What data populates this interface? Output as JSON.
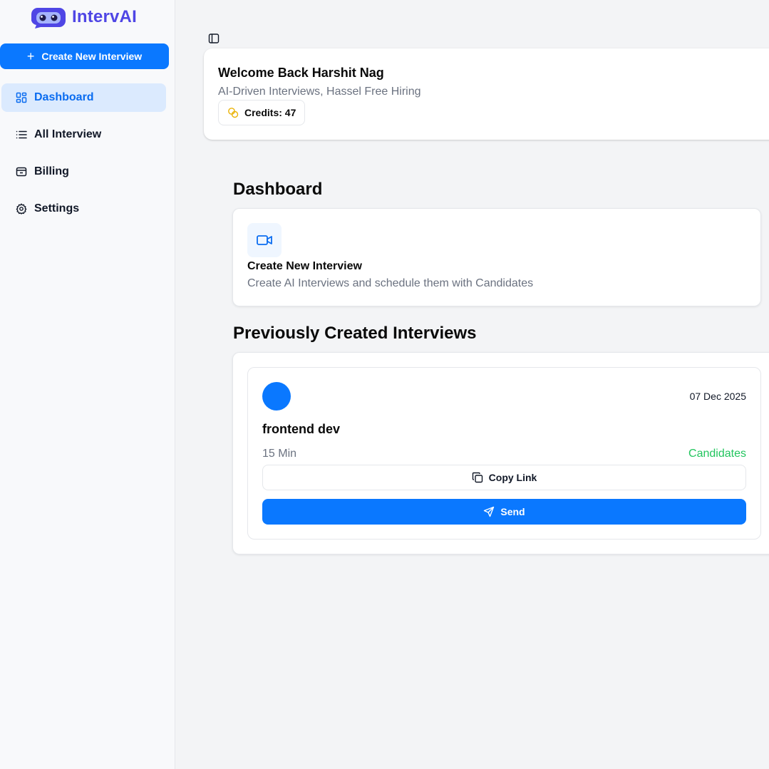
{
  "app": {
    "name": "IntervAI",
    "brand_color": "#4f46e5",
    "accent_color": "#0a78ff"
  },
  "sidebar": {
    "create_label": "Create New Interview",
    "items": [
      {
        "label": "Dashboard",
        "icon": "layout-grid-icon",
        "active": true
      },
      {
        "label": "All Interview",
        "icon": "list-icon",
        "active": false
      },
      {
        "label": "Billing",
        "icon": "wallet-icon",
        "active": false
      },
      {
        "label": "Settings",
        "icon": "gear-icon",
        "active": false
      }
    ]
  },
  "welcome": {
    "title": "Welcome Back Harshit Nag",
    "subtitle": "AI-Driven Interviews, Hassel Free Hiring",
    "credits": "Credits: 47"
  },
  "dashboard": {
    "title": "Dashboard",
    "create_card": {
      "title": "Create New Interview",
      "description": "Create AI Interviews and schedule them with Candidates"
    }
  },
  "previous": {
    "title": "Previously Created Interviews",
    "interviews": [
      {
        "date": "07 Dec 2025",
        "role": "frontend dev",
        "duration": "15 Min",
        "candidates_label": "Candidates",
        "copy_label": "Copy Link",
        "send_label": "Send"
      }
    ]
  }
}
